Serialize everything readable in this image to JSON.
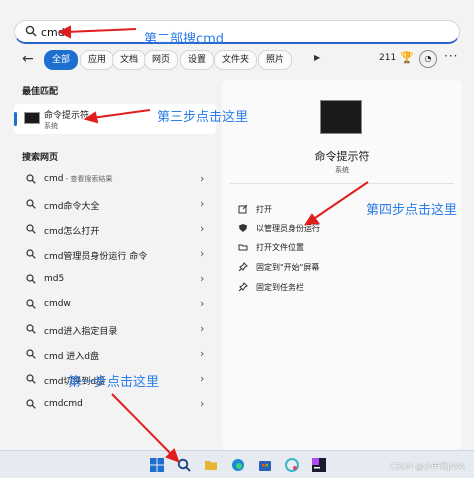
{
  "search": {
    "value": "cmd"
  },
  "filters": {
    "chips": [
      "全部",
      "应用",
      "文档",
      "网页",
      "设置",
      "文件夹",
      "照片"
    ],
    "count": "211"
  },
  "left": {
    "best_match_heading": "最佳匹配",
    "best_match": {
      "title": "命令提示符",
      "subtitle": "系统"
    },
    "web_heading": "搜索网页",
    "web_results": [
      {
        "text": "cmd",
        "sub": " - 查看搜索结果"
      },
      {
        "text": "cmd命令大全",
        "sub": ""
      },
      {
        "text": "cmd怎么打开",
        "sub": ""
      },
      {
        "text": "cmd管理员身份运行 命令",
        "sub": ""
      },
      {
        "text": "md5",
        "sub": ""
      },
      {
        "text": "cmdw",
        "sub": ""
      },
      {
        "text": "cmd进入指定目录",
        "sub": ""
      },
      {
        "text": "cmd 进入d盘",
        "sub": ""
      },
      {
        "text": "cmd切换到d盘",
        "sub": ""
      },
      {
        "text": "cmdcmd",
        "sub": ""
      }
    ]
  },
  "right": {
    "title": "命令提示符",
    "subtitle": "系统",
    "actions": [
      "打开",
      "以管理员身份运行",
      "打开文件位置",
      "固定到\"开始\"屏幕",
      "固定到任务栏"
    ]
  },
  "annotations": {
    "step2": "第二部搜cmd",
    "step3": "第三步点击这里",
    "step4": "第四步点击这里",
    "step1": "第一步点击这里"
  },
  "watermark": "CSDN @小申说JAVA",
  "colors": {
    "accent": "#1f6fd1",
    "annotation": "#2b7de9",
    "arrow": "#e01e1e"
  }
}
